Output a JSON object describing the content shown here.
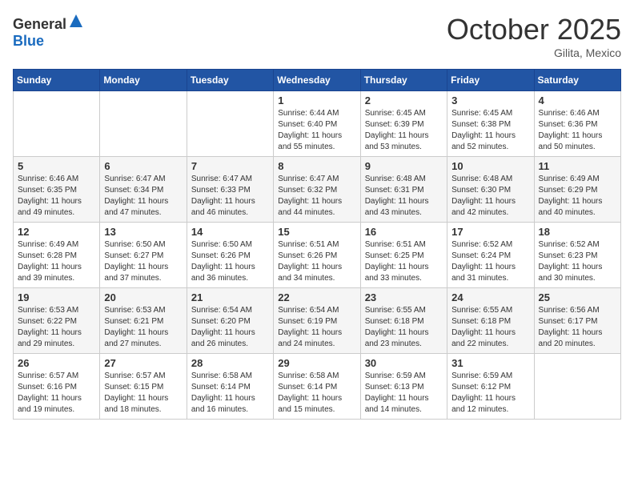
{
  "logo": {
    "general": "General",
    "blue": "Blue"
  },
  "header": {
    "month": "October 2025",
    "location": "Gilita, Mexico"
  },
  "days_of_week": [
    "Sunday",
    "Monday",
    "Tuesday",
    "Wednesday",
    "Thursday",
    "Friday",
    "Saturday"
  ],
  "weeks": [
    [
      {
        "day": "",
        "info": ""
      },
      {
        "day": "",
        "info": ""
      },
      {
        "day": "",
        "info": ""
      },
      {
        "day": "1",
        "info": "Sunrise: 6:44 AM\nSunset: 6:40 PM\nDaylight: 11 hours and 55 minutes."
      },
      {
        "day": "2",
        "info": "Sunrise: 6:45 AM\nSunset: 6:39 PM\nDaylight: 11 hours and 53 minutes."
      },
      {
        "day": "3",
        "info": "Sunrise: 6:45 AM\nSunset: 6:38 PM\nDaylight: 11 hours and 52 minutes."
      },
      {
        "day": "4",
        "info": "Sunrise: 6:46 AM\nSunset: 6:36 PM\nDaylight: 11 hours and 50 minutes."
      }
    ],
    [
      {
        "day": "5",
        "info": "Sunrise: 6:46 AM\nSunset: 6:35 PM\nDaylight: 11 hours and 49 minutes."
      },
      {
        "day": "6",
        "info": "Sunrise: 6:47 AM\nSunset: 6:34 PM\nDaylight: 11 hours and 47 minutes."
      },
      {
        "day": "7",
        "info": "Sunrise: 6:47 AM\nSunset: 6:33 PM\nDaylight: 11 hours and 46 minutes."
      },
      {
        "day": "8",
        "info": "Sunrise: 6:47 AM\nSunset: 6:32 PM\nDaylight: 11 hours and 44 minutes."
      },
      {
        "day": "9",
        "info": "Sunrise: 6:48 AM\nSunset: 6:31 PM\nDaylight: 11 hours and 43 minutes."
      },
      {
        "day": "10",
        "info": "Sunrise: 6:48 AM\nSunset: 6:30 PM\nDaylight: 11 hours and 42 minutes."
      },
      {
        "day": "11",
        "info": "Sunrise: 6:49 AM\nSunset: 6:29 PM\nDaylight: 11 hours and 40 minutes."
      }
    ],
    [
      {
        "day": "12",
        "info": "Sunrise: 6:49 AM\nSunset: 6:28 PM\nDaylight: 11 hours and 39 minutes."
      },
      {
        "day": "13",
        "info": "Sunrise: 6:50 AM\nSunset: 6:27 PM\nDaylight: 11 hours and 37 minutes."
      },
      {
        "day": "14",
        "info": "Sunrise: 6:50 AM\nSunset: 6:26 PM\nDaylight: 11 hours and 36 minutes."
      },
      {
        "day": "15",
        "info": "Sunrise: 6:51 AM\nSunset: 6:26 PM\nDaylight: 11 hours and 34 minutes."
      },
      {
        "day": "16",
        "info": "Sunrise: 6:51 AM\nSunset: 6:25 PM\nDaylight: 11 hours and 33 minutes."
      },
      {
        "day": "17",
        "info": "Sunrise: 6:52 AM\nSunset: 6:24 PM\nDaylight: 11 hours and 31 minutes."
      },
      {
        "day": "18",
        "info": "Sunrise: 6:52 AM\nSunset: 6:23 PM\nDaylight: 11 hours and 30 minutes."
      }
    ],
    [
      {
        "day": "19",
        "info": "Sunrise: 6:53 AM\nSunset: 6:22 PM\nDaylight: 11 hours and 29 minutes."
      },
      {
        "day": "20",
        "info": "Sunrise: 6:53 AM\nSunset: 6:21 PM\nDaylight: 11 hours and 27 minutes."
      },
      {
        "day": "21",
        "info": "Sunrise: 6:54 AM\nSunset: 6:20 PM\nDaylight: 11 hours and 26 minutes."
      },
      {
        "day": "22",
        "info": "Sunrise: 6:54 AM\nSunset: 6:19 PM\nDaylight: 11 hours and 24 minutes."
      },
      {
        "day": "23",
        "info": "Sunrise: 6:55 AM\nSunset: 6:18 PM\nDaylight: 11 hours and 23 minutes."
      },
      {
        "day": "24",
        "info": "Sunrise: 6:55 AM\nSunset: 6:18 PM\nDaylight: 11 hours and 22 minutes."
      },
      {
        "day": "25",
        "info": "Sunrise: 6:56 AM\nSunset: 6:17 PM\nDaylight: 11 hours and 20 minutes."
      }
    ],
    [
      {
        "day": "26",
        "info": "Sunrise: 6:57 AM\nSunset: 6:16 PM\nDaylight: 11 hours and 19 minutes."
      },
      {
        "day": "27",
        "info": "Sunrise: 6:57 AM\nSunset: 6:15 PM\nDaylight: 11 hours and 18 minutes."
      },
      {
        "day": "28",
        "info": "Sunrise: 6:58 AM\nSunset: 6:14 PM\nDaylight: 11 hours and 16 minutes."
      },
      {
        "day": "29",
        "info": "Sunrise: 6:58 AM\nSunset: 6:14 PM\nDaylight: 11 hours and 15 minutes."
      },
      {
        "day": "30",
        "info": "Sunrise: 6:59 AM\nSunset: 6:13 PM\nDaylight: 11 hours and 14 minutes."
      },
      {
        "day": "31",
        "info": "Sunrise: 6:59 AM\nSunset: 6:12 PM\nDaylight: 11 hours and 12 minutes."
      },
      {
        "day": "",
        "info": ""
      }
    ]
  ]
}
